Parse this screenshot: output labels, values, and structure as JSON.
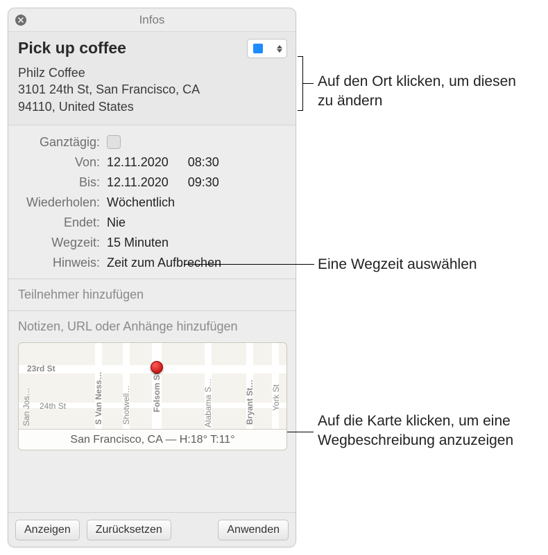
{
  "titlebar": {
    "label": "Infos"
  },
  "event": {
    "title": "Pick up coffee",
    "location_name": "Philz Coffee",
    "location_line1": "3101 24th St, San Francisco, CA",
    "location_line2": "94110, United States"
  },
  "fields": {
    "allday_label": "Ganztägig:",
    "from_label": "Von:",
    "from_date": "12.11.2020",
    "from_time": "08:30",
    "to_label": "Bis:",
    "to_date": "12.11.2020",
    "to_time": "09:30",
    "repeat_label": "Wiederholen:",
    "repeat_value": "Wöchentlich",
    "ends_label": "Endet:",
    "ends_value": "Nie",
    "travel_label": "Wegzeit:",
    "travel_value": "15 Minuten",
    "alert_label": "Hinweis:",
    "alert_value": "Zeit zum Aufbrechen"
  },
  "invitees": {
    "placeholder": "Teilnehmer hinzufügen"
  },
  "notes": {
    "placeholder": "Notizen, URL oder Anhänge hinzufügen"
  },
  "map": {
    "weather": "San Francisco, CA — H:18° T:11°",
    "labels": {
      "l23": "23rd St",
      "l24": "24th St",
      "svn": "S Van Ness…",
      "shot": "Shotwell…",
      "fol": "Folsom St",
      "ala": "Alabama S…",
      "bry": "Bryant St…",
      "york": "York St",
      "sj": "San Jos…"
    }
  },
  "buttons": {
    "show": "Anzeigen",
    "reset": "Zurücksetzen",
    "apply": "Anwenden"
  },
  "annotations": {
    "location": "Auf den Ort klicken, um diesen zu ändern",
    "travel": "Eine Wegzeit auswählen",
    "map": "Auf die Karte klicken, um eine Wegbeschreibung anzuzeigen"
  }
}
